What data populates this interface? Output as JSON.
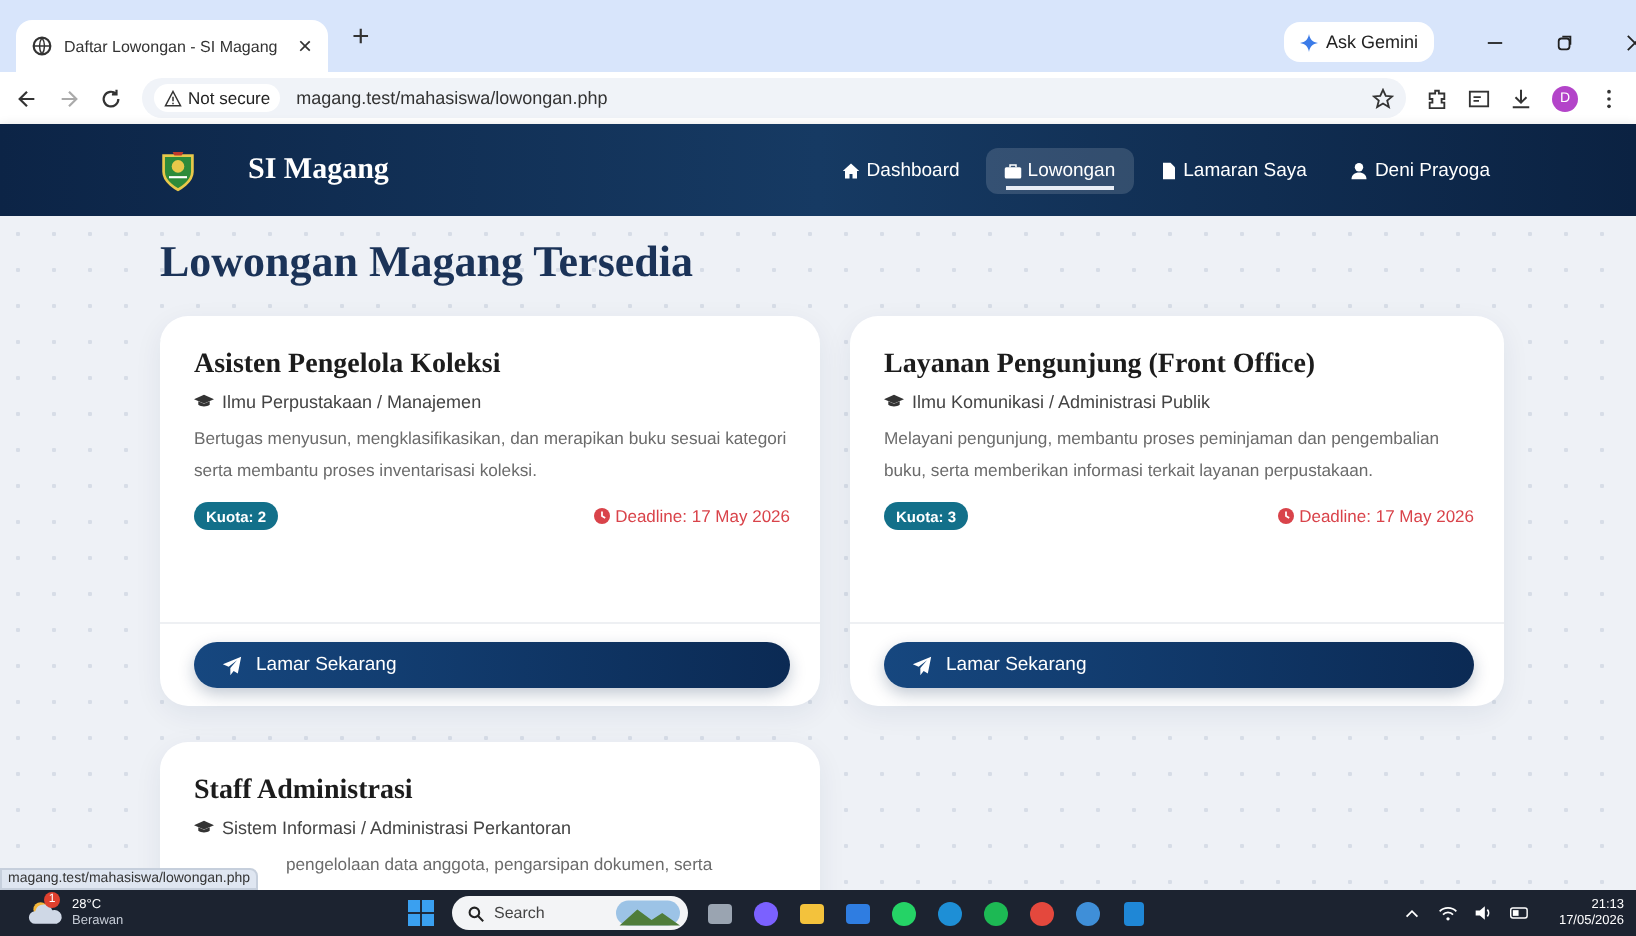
{
  "browser": {
    "tab": {
      "title": "Daftar Lowongan - SI Magang",
      "close": "×",
      "selected": true
    },
    "new_tab": "+",
    "gemini": "Ask Gemini",
    "security": "Not secure",
    "url": "magang.test/mahasiswa/lowongan.php",
    "profile": "D"
  },
  "navbar": {
    "brand": "SI Magang",
    "items": [
      {
        "label": "Dashboard",
        "kind": "home",
        "selected": false
      },
      {
        "label": "Lowongan",
        "kind": "briefcase",
        "selected": true
      },
      {
        "label": "Lamaran Saya",
        "kind": "file",
        "selected": false
      },
      {
        "label": "Deni Prayoga",
        "kind": "user",
        "selected": false
      }
    ]
  },
  "page": {
    "title": "Lowongan Magang Tersedia",
    "cards": [
      {
        "title": "Asisten Pengelola Koleksi",
        "field": "Ilmu Perpustakaan / Manajemen",
        "description": "Bertugas menyusun, mengklasifikasikan, dan merapikan buku sesuai kategori serta membantu proses inventarisasi koleksi.",
        "quota": "Kuota: 2",
        "deadline": "Deadline: 17 May 2026",
        "button": "Lamar Sekarang"
      },
      {
        "title": "Layanan Pengunjung (Front Office)",
        "field": "Ilmu Komunikasi / Administrasi Publik",
        "description": "Melayani pengunjung, membantu proses peminjaman dan pengembalian buku, serta memberikan informasi terkait layanan perpustakaan.",
        "quota": "Kuota: 3",
        "deadline": "Deadline: 17 May 2026",
        "button": "Lamar Sekarang"
      },
      {
        "title": "Staff Administrasi",
        "field": "Sistem Informasi / Administrasi Perkantoran",
        "description": "pengelolaan data anggota, pengarsipan dokumen, serta",
        "partly_hidden": true
      }
    ]
  },
  "status_url": "magang.test/mahasiswa/lowongan.php",
  "taskbar": {
    "weather": {
      "temp": "28°C",
      "condition": "Berawan",
      "badge": "1"
    },
    "search": "Search",
    "apps": [
      {
        "kind": "taskview"
      },
      {
        "kind": "copilot"
      },
      {
        "kind": "folder"
      },
      {
        "kind": "store"
      },
      {
        "kind": "whatsapp"
      },
      {
        "kind": "edge"
      },
      {
        "kind": "spotify"
      },
      {
        "kind": "chrome"
      },
      {
        "kind": "whale"
      },
      {
        "kind": "vscode"
      }
    ],
    "time": "21:13",
    "date": "17/05/2026"
  }
}
